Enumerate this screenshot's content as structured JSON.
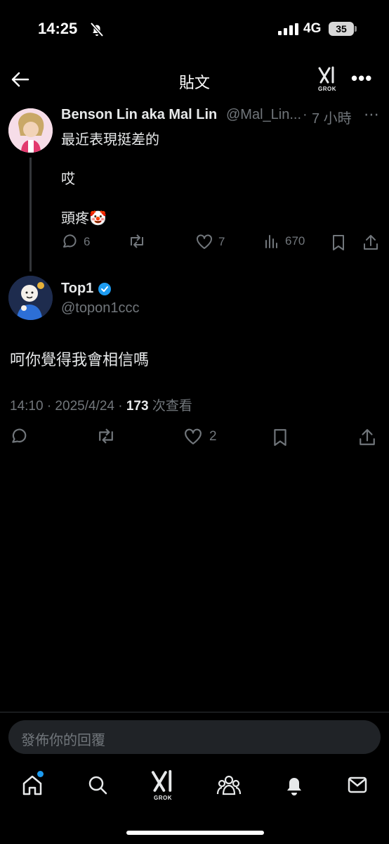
{
  "status_bar": {
    "time": "14:25",
    "network": "4G",
    "battery": "35"
  },
  "header": {
    "title": "貼文",
    "grok_label": "GROK"
  },
  "parent_tweet": {
    "author_name": "Benson Lin aka Mal Lin",
    "handle": "@Mal_Lin...",
    "separator": "·",
    "time_ago": "7 小時",
    "line1": "最近表現挺差的",
    "line2": "哎",
    "line3": "頭疼🤡",
    "replies": "6",
    "likes": "7",
    "views": "670",
    "more": "⋯"
  },
  "main_tweet": {
    "author_name": "Top1",
    "handle": "@topon1ccc",
    "text": "呵你覺得我會相信嗎",
    "timestamp": "14:10 · 2025/4/24 · ",
    "view_count": "173",
    "view_label": " 次查看",
    "likes": "2"
  },
  "reply_box": {
    "placeholder": "發佈你的回覆"
  },
  "nav": {
    "grok_label": "GROK"
  },
  "colors": {
    "accent": "#1d9bf0",
    "muted": "#71767b",
    "text": "#e7e9ea",
    "background": "#000000"
  }
}
